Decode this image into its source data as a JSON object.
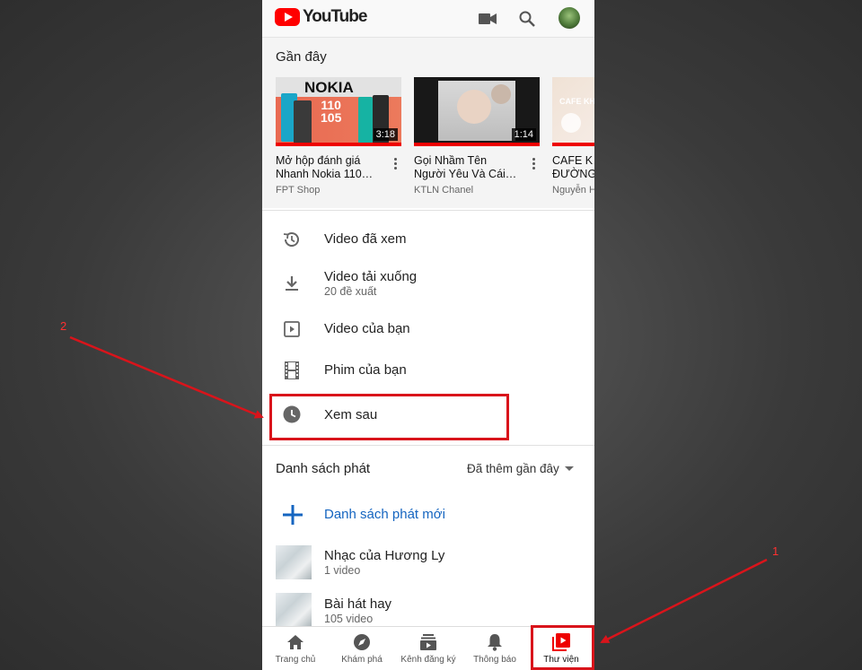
{
  "app": {
    "logo_text": "YouTube",
    "accent": "#ff0000"
  },
  "top_actions": [
    "camera-icon",
    "search-icon",
    "account-avatar"
  ],
  "recent": {
    "title": "Gần đây",
    "videos": [
      {
        "thumb_text": "NOKIA",
        "thumb_text2": "110\n105",
        "duration": "3:18",
        "title": "Mở hộp đánh giá\nNhanh Nokia 110…",
        "channel": "FPT Shop"
      },
      {
        "thumb_text": "",
        "duration": "1:14",
        "title": "Gọi Nhầm Tên\nNgười Yêu Và Cái…",
        "channel": "KTLN Chanel"
      },
      {
        "thumb_text": "CAFE KHONG",
        "duration": "",
        "title": "CAFE K\nĐƯỜNG",
        "channel": "Nguyễn H"
      }
    ]
  },
  "library": {
    "history": "Video đã xem",
    "downloads": "Video tải xuống",
    "downloads_sub": "20 đề xuất",
    "your_videos": "Video của bạn",
    "your_movies": "Phim của bạn",
    "watch_later": "Xem sau"
  },
  "playlists": {
    "title": "Danh sách phát",
    "sort_label": "Đã thêm gần đây",
    "new_label": "Danh sách phát mới",
    "items": [
      {
        "name": "Nhạc của Hương Ly",
        "count": "1 video"
      },
      {
        "name": "Bài hát hay",
        "count": "105 video"
      }
    ]
  },
  "bottom_nav": [
    {
      "label": "Trang chủ",
      "icon": "home-icon"
    },
    {
      "label": "Khám phá",
      "icon": "explore-icon"
    },
    {
      "label": "Kênh đăng ký",
      "icon": "subscriptions-icon"
    },
    {
      "label": "Thông báo",
      "icon": "bell-icon"
    },
    {
      "label": "Thư viện",
      "icon": "library-icon",
      "active": true
    }
  ],
  "annotations": {
    "label_1": "1",
    "label_2": "2",
    "color": "#d9141b"
  }
}
